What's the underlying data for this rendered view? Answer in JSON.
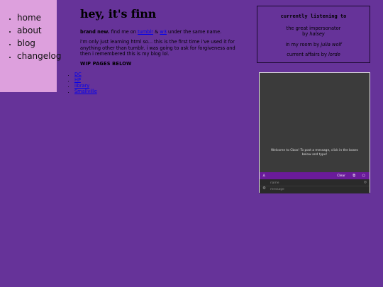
{
  "nav": {
    "items": [
      {
        "label": "home"
      },
      {
        "label": "about"
      },
      {
        "label": "blog"
      },
      {
        "label": "changelog"
      }
    ]
  },
  "main": {
    "title": "hey, it's finn",
    "intro_bold": "brand new.",
    "intro_text1": " find me on ",
    "link_tumblr": "tumblr",
    "intro_and": " & ",
    "link_w3": "w3",
    "intro_text2": " under the same name.",
    "para2": "i'm only just learning html so... this is the first time i've used it for anything other than tumblr. i was going to ask for forgiveness and then i remembered this is my blog lol.",
    "wip_heading": "WIP PAGES BELOW",
    "wip_links": [
      {
        "label": "DC"
      },
      {
        "label": "HP"
      },
      {
        "label": "library"
      },
      {
        "label": "Smallville"
      }
    ]
  },
  "listening": {
    "heading": "currently listening to",
    "songs": [
      {
        "title": "the great impersonator",
        "by": "by ",
        "artist": "halsey"
      },
      {
        "title": "in my room",
        "by": " by ",
        "artist": "julia wolf"
      },
      {
        "title": "current affairs",
        "by": " by ",
        "artist": "lorde"
      }
    ]
  },
  "cbox": {
    "welcome": "Welcome to Cbox! To post a message, click in the boxes below and type!",
    "user_icon": "user-icon",
    "clear_label": "Clear",
    "external_icon": "external-link-icon",
    "circle_icon": "circle-icon",
    "name_placeholder": "name",
    "message_placeholder": "message",
    "eye_icon": "eye-icon",
    "gear_icon": "gear-icon"
  },
  "colors": {
    "background": "#663399",
    "sidebar": "#dda0dd",
    "cbox_bar": "#6a1b9a"
  }
}
